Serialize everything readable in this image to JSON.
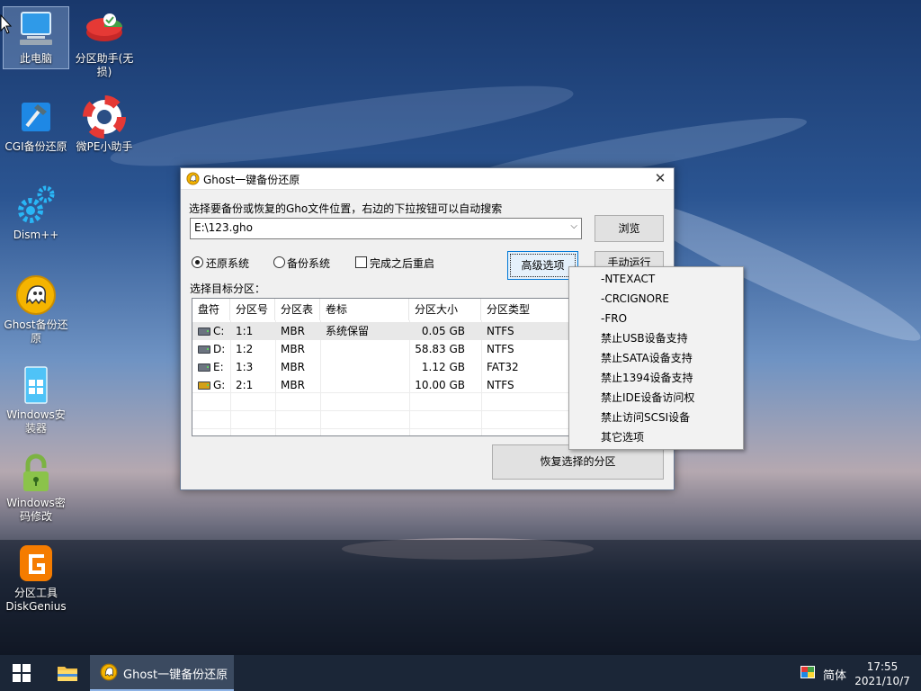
{
  "desktop": {
    "icons": [
      {
        "label": "此电脑",
        "icon": "computer-icon"
      },
      {
        "label": "分区助手(无损)",
        "icon": "partition-assistant-icon"
      },
      {
        "label": "CGI备份还原",
        "icon": "cgi-backup-icon"
      },
      {
        "label": "微PE小助手",
        "icon": "lifebuoy-icon"
      },
      {
        "label": "Dism++",
        "icon": "gears-icon"
      },
      {
        "label": "Ghost备份还原",
        "icon": "ghost-icon"
      },
      {
        "label": "Windows安装器",
        "icon": "windows-installer-icon"
      },
      {
        "label": "Windows密码修改",
        "icon": "padlock-icon"
      },
      {
        "label": "分区工具DiskGenius",
        "icon": "diskgenius-icon"
      }
    ]
  },
  "dialog": {
    "title": "Ghost一键备份还原",
    "instruction": "选择要备份或恢复的Gho文件位置，右边的下拉按钮可以自动搜索",
    "path_value": "E:\\123.gho",
    "browse_label": "浏览",
    "radio_restore": "还原系统",
    "radio_backup": "备份系统",
    "checkbox_restart": "完成之后重启",
    "advanced_label": "高级选项",
    "manual_label": "手动运行",
    "target_label": "选择目标分区：",
    "restore_button": "恢复选择的分区",
    "table": {
      "headers": [
        "盘符",
        "分区号",
        "分区表",
        "卷标",
        "分区大小",
        "分区类型"
      ],
      "rows": [
        {
          "drive": "C:",
          "part": "1:1",
          "table": "MBR",
          "label": "系统保留",
          "size": "0.05 GB",
          "type": "NTFS"
        },
        {
          "drive": "D:",
          "part": "1:2",
          "table": "MBR",
          "label": "",
          "size": "58.83 GB",
          "type": "NTFS"
        },
        {
          "drive": "E:",
          "part": "1:3",
          "table": "MBR",
          "label": "",
          "size": "1.12 GB",
          "type": "FAT32"
        },
        {
          "drive": "G:",
          "part": "2:1",
          "table": "MBR",
          "label": "",
          "size": "10.00 GB",
          "type": "NTFS"
        }
      ]
    }
  },
  "context_menu": {
    "items": [
      "-NTEXACT",
      "-CRCIGNORE",
      "-FRO",
      "禁止USB设备支持",
      "禁止SATA设备支持",
      "禁止1394设备支持",
      "禁止IDE设备访问权",
      "禁止访问SCSI设备",
      "其它选项"
    ]
  },
  "taskbar": {
    "app_label": "Ghost一键备份还原",
    "ime": "简体",
    "time": "17:55",
    "date": "2021/10/7"
  },
  "colors": {
    "accent": "#0078d7",
    "taskbar": "#1b2637"
  }
}
